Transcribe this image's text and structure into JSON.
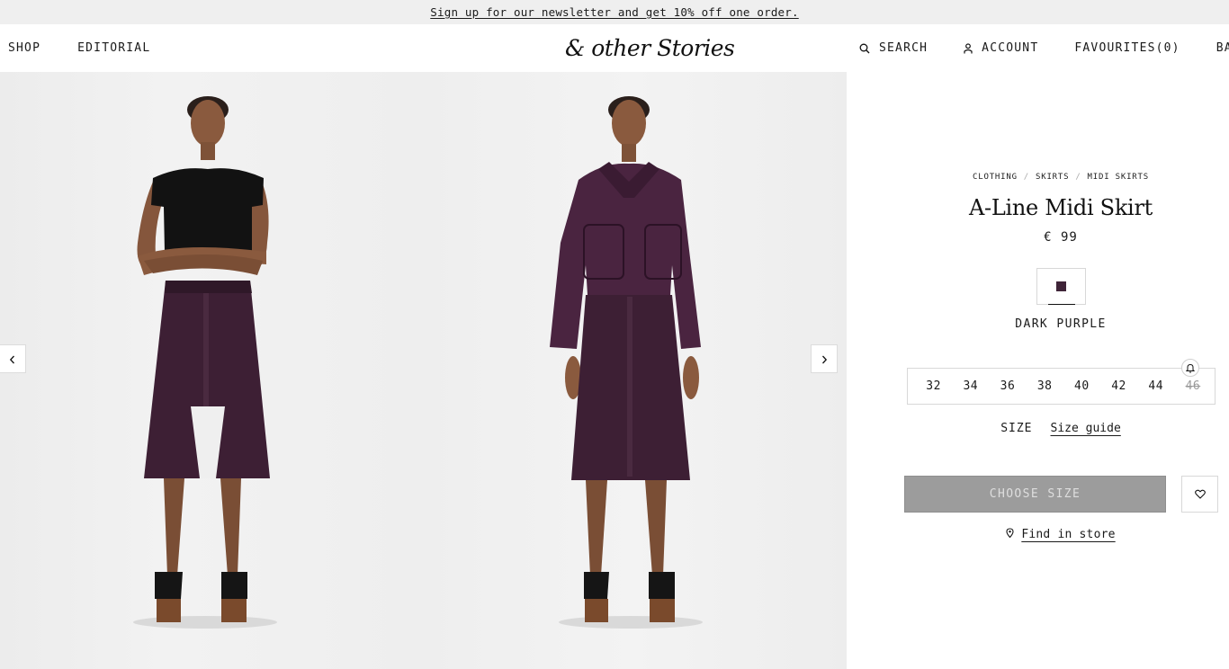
{
  "banner": {
    "text": "Sign up for our newsletter and get 10% off one order."
  },
  "nav": {
    "left": [
      "SHOP",
      "EDITORIAL"
    ],
    "logo": "& other Stories",
    "search": "SEARCH",
    "account": "ACCOUNT",
    "favourites": "FAVOURITES(0)",
    "bag": "BA"
  },
  "icons": {
    "search": "search-icon",
    "account": "person-icon",
    "prev": "chevron-left-icon",
    "next": "chevron-right-icon",
    "bell": "bell-icon",
    "heart": "heart-icon",
    "pin": "location-pin-icon"
  },
  "breadcrumb": [
    "CLOTHING",
    "SKIRTS",
    "MIDI SKIRTS"
  ],
  "product": {
    "title": "A-Line Midi Skirt",
    "price": "€ 99",
    "color_name": "DARK PURPLE",
    "color_hex": "#3f2438",
    "sizes": [
      {
        "label": "32",
        "available": true
      },
      {
        "label": "34",
        "available": true
      },
      {
        "label": "36",
        "available": true
      },
      {
        "label": "38",
        "available": true
      },
      {
        "label": "40",
        "available": true
      },
      {
        "label": "42",
        "available": true
      },
      {
        "label": "44",
        "available": true
      },
      {
        "label": "46",
        "available": false
      }
    ],
    "size_label": "SIZE",
    "size_guide": "Size guide",
    "cta": "CHOOSE SIZE",
    "find_in_store": "Find in store"
  },
  "colors": {
    "skirt": "#3d1f34",
    "cta_bg": "#9c9c9c"
  }
}
